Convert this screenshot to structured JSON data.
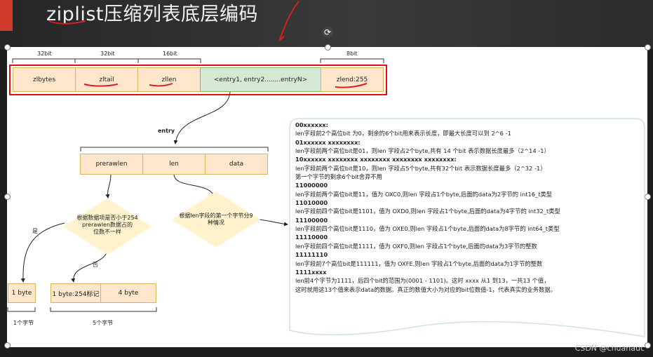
{
  "slide": {
    "title": "ziplist压缩列表底层编码",
    "watermark": "CSDN @chuanauc"
  },
  "diagram": {
    "header_row": {
      "bits": [
        "32bit",
        "32bit",
        "16bit",
        "8bit"
      ],
      "cells": [
        "zlbytes",
        "zltail",
        "zllen",
        "<entry1, entry2........entryN>",
        "zlend:255"
      ]
    },
    "entry_label": "entry",
    "entry_row": [
      "prerawlen",
      "len",
      "data"
    ],
    "decision_left": [
      "根据数据项是否小于254",
      "prerawlen数据占的",
      "位数不一样"
    ],
    "decision_right": [
      "根据len字段的第一个字节分9",
      "种情况"
    ],
    "yes_label": "是",
    "no_label": "否",
    "small_box": "1 byte",
    "small_box_caption": "1个字节",
    "big_boxes": [
      "1 byte:254标记",
      "4 byte"
    ],
    "big_box_caption": "5个字节"
  },
  "notes": [
    {
      "bold": true,
      "text": "00xxxxxx:"
    },
    {
      "bold": false,
      "text": "len字段前2个高位bit 为0，剩余的6个bit用来表示长度，即最大长度可以到 2^6 -1"
    },
    {
      "bold": true,
      "text": "01xxxxxx xxxxxxxx:"
    },
    {
      "bold": false,
      "text": "len字段前两个高位bit是01，则len 字段占2个byte,共有 14 个bit 表示数据长度最多（2^14 -1）"
    },
    {
      "bold": true,
      "text": "10xxxxxx xxxxxxxx xxxxxxxx xxxxxxxx xxxxxxxx:"
    },
    {
      "bold": false,
      "text": "len字段前两个高位bit是10，则len 字段占5个byte,共有32个bit 表示数据长度最多（2^32 -1）"
    },
    {
      "bold": false,
      "text": "第一个字节的剩余6个bit舍弃不用"
    },
    {
      "bold": true,
      "text": "11000000"
    },
    {
      "bold": false,
      "text": "len字段前两个高位bit是11，值为 OXC0,则len 字段占1个byte,后面的data为2字节的 int16_t类型"
    },
    {
      "bold": true,
      "text": "11010000"
    },
    {
      "bold": false,
      "text": "len字段前四个高位bit是1101，值为 OXD0,则len 字段占1个byte,后面的data为4字节的 int32_t类型"
    },
    {
      "bold": true,
      "text": "11100000"
    },
    {
      "bold": false,
      "text": "len字段前四个高位bit是1110，值为 OXE0,则len 字段占1个byte,后面的data为8字节的 int64_t类型"
    },
    {
      "bold": true,
      "text": "11110000"
    },
    {
      "bold": false,
      "text": "len字段前四个高位bit是1111，值为 OXF0,则len 字段占1个byte,后面的data为3字节的整数"
    },
    {
      "bold": true,
      "text": "11111110"
    },
    {
      "bold": false,
      "text": "len字段前7个高位bit是111111，值为 OXFE,则len 字段占1个byte,后面的data为1字节的整数"
    },
    {
      "bold": true,
      "text": "1111xxxx"
    },
    {
      "bold": false,
      "text": "len前4个字节为1111，后四个bit的范围为(0001 - 1101)。这时 xxxx 从1 到13，一共13 个值，"
    },
    {
      "bold": false,
      "text": "这时就用这13个值来表示data的数据。真正的数值大小为对应的bit位数值-1，代表真实的业务数据。"
    }
  ]
}
